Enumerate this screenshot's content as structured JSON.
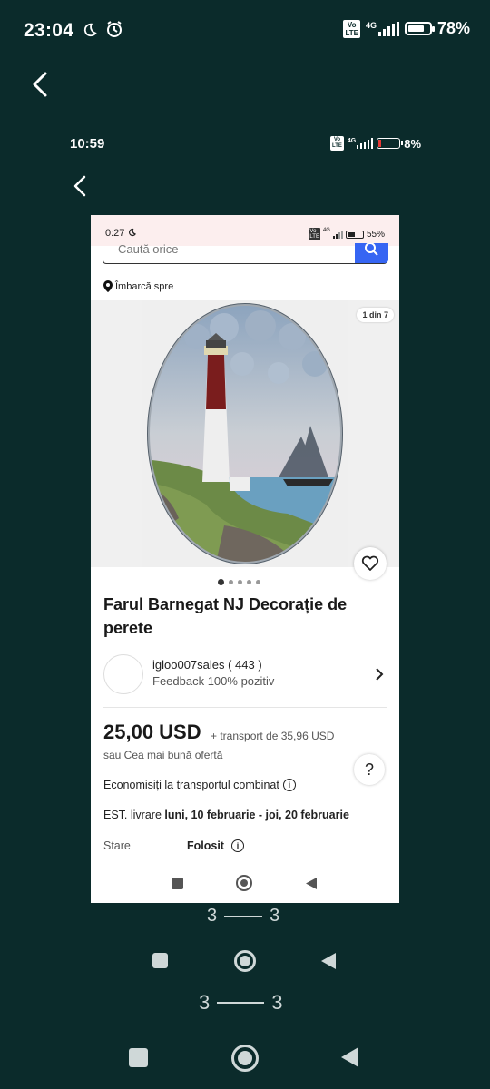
{
  "outer_status": {
    "time": "23:04",
    "volte": "Vo LTE",
    "net": "4G",
    "battery": "78%",
    "battery_level": 0.78
  },
  "middle_status": {
    "time": "10:59",
    "volte": "Vo LTE",
    "net": "4G",
    "battery": "8%",
    "battery_level": 0.08
  },
  "inner_status": {
    "time": "0:27",
    "net": "4G",
    "battery": "55%",
    "battery_level": 0.55
  },
  "app": {
    "search_placeholder": "Caută orice",
    "ship_to": "Îmbarcă spre",
    "gallery_counter": "1 din 7",
    "gallery_pages": 5,
    "gallery_active": 0,
    "title": "Farul Barnegat NJ Decorație de perete",
    "seller": {
      "name": "igloo007sales ( 443 )",
      "feedback": "Feedback 100% pozitiv"
    },
    "price": "25,00 USD",
    "shipping": "+ transport de 35,96 USD",
    "best_offer": "sau Cea mai bună ofertă",
    "combined_shipping": "Economisiți la transportul combinat",
    "delivery_prefix": "EST. livrare",
    "delivery_dates": "luni, 10 februarie - joi, 20 februarie",
    "condition_label": "Stare",
    "condition_value": "Folosit",
    "help": "?"
  },
  "seps": {
    "left": "3",
    "right": "3"
  },
  "icons": [
    "back-arrow-icon",
    "moon-icon",
    "alarm-icon",
    "signal-icon",
    "battery-icon",
    "search-icon",
    "location-pin-icon",
    "heart-icon",
    "chevron-right-icon",
    "info-icon",
    "help-icon",
    "nav-square-icon",
    "nav-home-icon",
    "nav-back-icon"
  ]
}
